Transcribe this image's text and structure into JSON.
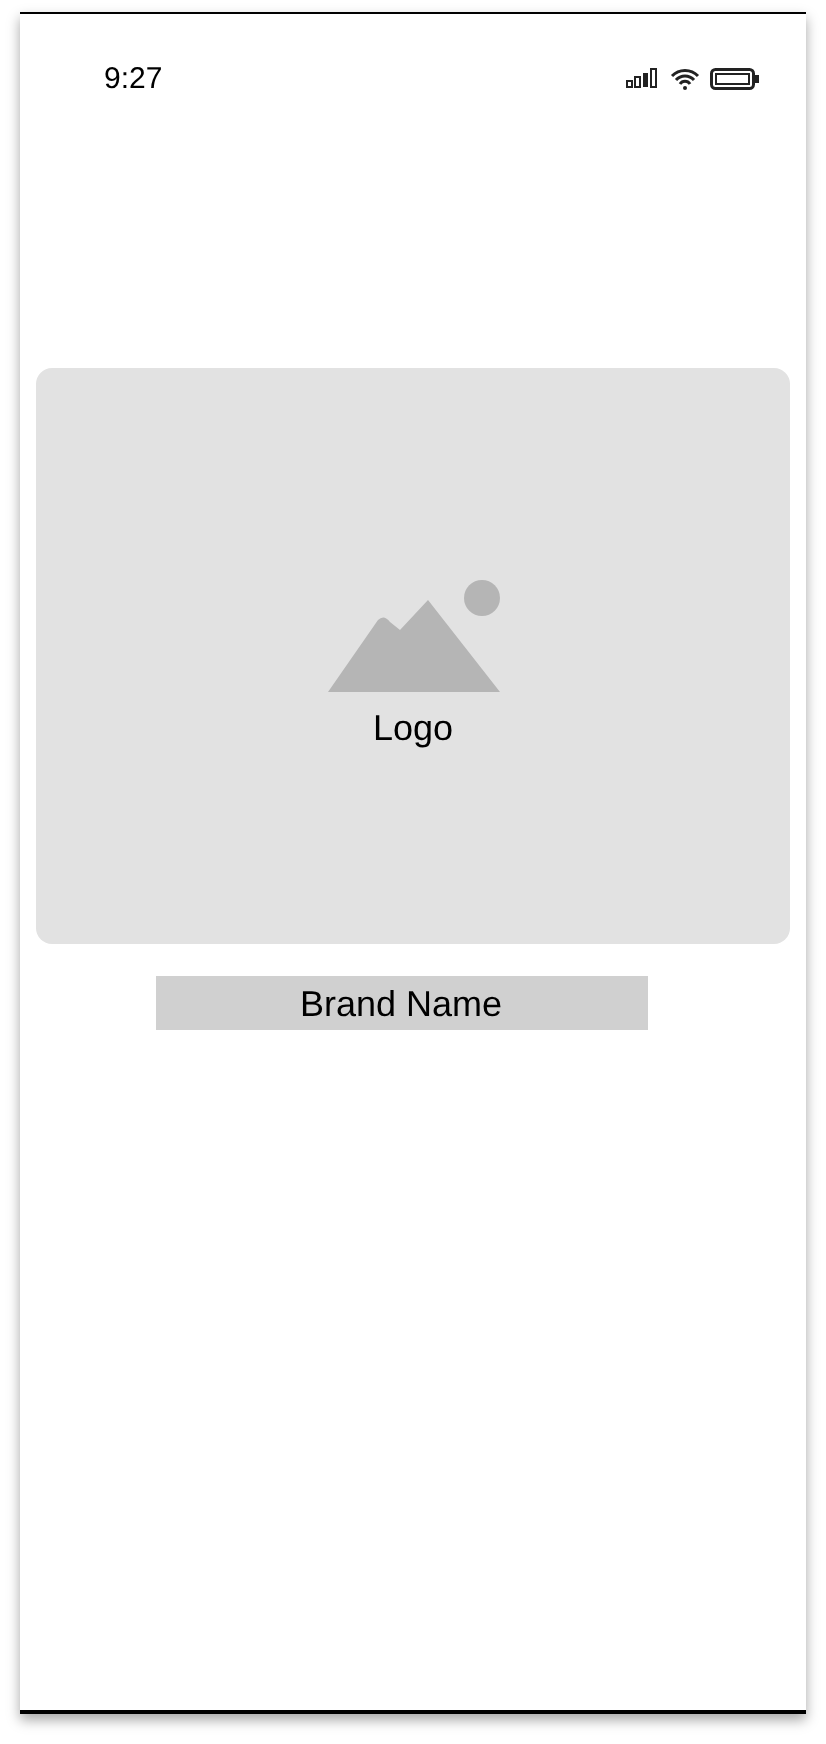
{
  "status_bar": {
    "time": "9:27"
  },
  "logo_placeholder": {
    "label": "Logo"
  },
  "brand_name": "Brand Name"
}
